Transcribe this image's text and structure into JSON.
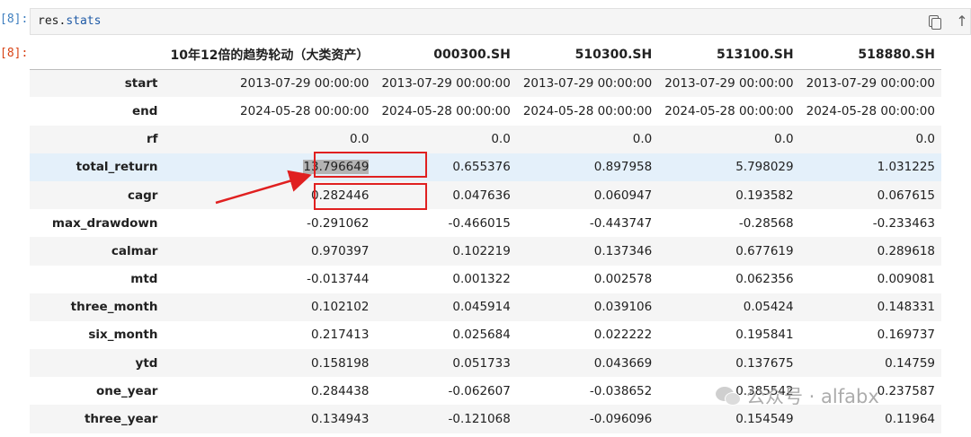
{
  "input_cell": {
    "prompt": "[8]:",
    "code_object": "res",
    "code_dot": ".",
    "code_attr": "stats"
  },
  "output_cell": {
    "prompt": "[8]:"
  },
  "toolbar": {
    "icons": [
      "copy-icon",
      "arrow-up-icon"
    ],
    "arrow_glyph": "↑"
  },
  "table": {
    "columns": [
      "10年12倍的趋势轮动（大类资产）",
      "000300.SH",
      "510300.SH",
      "513100.SH",
      "518880.SH"
    ],
    "rows": [
      {
        "label": "start",
        "values": [
          "2013-07-29 00:00:00",
          "2013-07-29 00:00:00",
          "2013-07-29 00:00:00",
          "2013-07-29 00:00:00",
          "2013-07-29 00:00:00"
        ]
      },
      {
        "label": "end",
        "values": [
          "2024-05-28 00:00:00",
          "2024-05-28 00:00:00",
          "2024-05-28 00:00:00",
          "2024-05-28 00:00:00",
          "2024-05-28 00:00:00"
        ]
      },
      {
        "label": "rf",
        "values": [
          "0.0",
          "0.0",
          "0.0",
          "0.0",
          "0.0"
        ]
      },
      {
        "label": "total_return",
        "values": [
          "13.796649",
          "0.655376",
          "0.897958",
          "5.798029",
          "1.031225"
        ]
      },
      {
        "label": "cagr",
        "values": [
          "0.282446",
          "0.047636",
          "0.060947",
          "0.193582",
          "0.067615"
        ]
      },
      {
        "label": "max_drawdown",
        "values": [
          "-0.291062",
          "-0.466015",
          "-0.443747",
          "-0.28568",
          "-0.233463"
        ]
      },
      {
        "label": "calmar",
        "values": [
          "0.970397",
          "0.102219",
          "0.137346",
          "0.677619",
          "0.289618"
        ]
      },
      {
        "label": "mtd",
        "values": [
          "-0.013744",
          "0.001322",
          "0.002578",
          "0.062356",
          "0.009081"
        ]
      },
      {
        "label": "three_month",
        "values": [
          "0.102102",
          "0.045914",
          "0.039106",
          "0.05424",
          "0.148331"
        ]
      },
      {
        "label": "six_month",
        "values": [
          "0.217413",
          "0.025684",
          "0.022222",
          "0.195841",
          "0.169737"
        ]
      },
      {
        "label": "ytd",
        "values": [
          "0.158198",
          "0.051733",
          "0.043669",
          "0.137675",
          "0.14759"
        ]
      },
      {
        "label": "one_year",
        "values": [
          "0.284438",
          "-0.062607",
          "-0.038652",
          "0.385542",
          "0.237587"
        ]
      },
      {
        "label": "three_year",
        "values": [
          "0.134943",
          "-0.121068",
          "-0.096096",
          "0.154549",
          "0.11964"
        ]
      }
    ]
  },
  "annotation": {
    "highlight_color": "#e02020"
  },
  "watermark": {
    "text": "公众号 · alfabx",
    "icon": "wechat-icon"
  }
}
